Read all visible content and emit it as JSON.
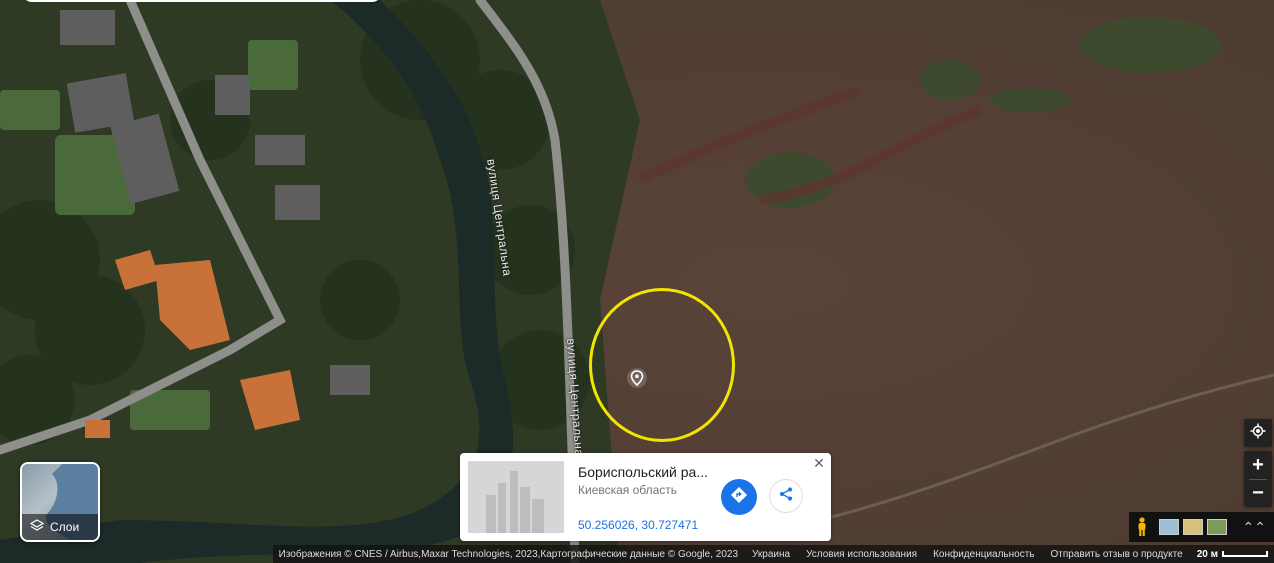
{
  "map": {
    "road_labels": [
      "вулиця Центральна",
      "вулиця Центральна"
    ]
  },
  "layers_button": {
    "label": "Слои",
    "icon": "layers-icon"
  },
  "place_card": {
    "title": "Бориспольский ра...",
    "subtitle": "Киевская область",
    "coordinates": "50.256026, 30.727471",
    "close_label": "✕",
    "directions_icon": "directions-icon",
    "share_icon": "share-icon"
  },
  "controls": {
    "zoom_in": "+",
    "zoom_out": "−",
    "expand": "⌃⌃"
  },
  "footer": {
    "attribution": "Изображения © CNES / Airbus,Maxar Technologies, 2023,Картографические данные © Google, 2023",
    "country": "Украина",
    "terms": "Условия использования",
    "privacy": "Конфиденциальность",
    "feedback": "Отправить отзыв о продукте",
    "scale": "20 м"
  },
  "colors": {
    "highlight": "#f2e600",
    "accent": "#1a73e8"
  }
}
